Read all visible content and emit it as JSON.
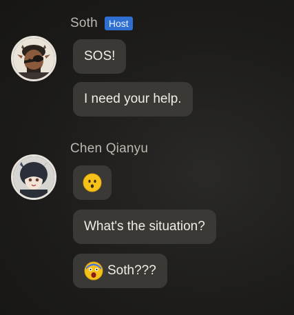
{
  "messages": [
    {
      "sender": "Soth",
      "badge": "Host",
      "avatar_icon": "soth-avatar-icon",
      "bubbles": [
        {
          "text": "SOS!"
        },
        {
          "text": "I need your help."
        }
      ]
    },
    {
      "sender": "Chen Qianyu",
      "avatar_icon": "chen-avatar-icon",
      "bubbles": [
        {
          "emoji": "surprised-face-icon",
          "text": ""
        },
        {
          "text": "What's the situation?"
        },
        {
          "emoji": "shocked-face-icon",
          "text": "Soth???"
        }
      ]
    }
  ],
  "colors": {
    "background": "#1d1c1a",
    "bubble": "#3a3936",
    "badge": "#2f6fd1",
    "name": "#bdb9b1"
  }
}
